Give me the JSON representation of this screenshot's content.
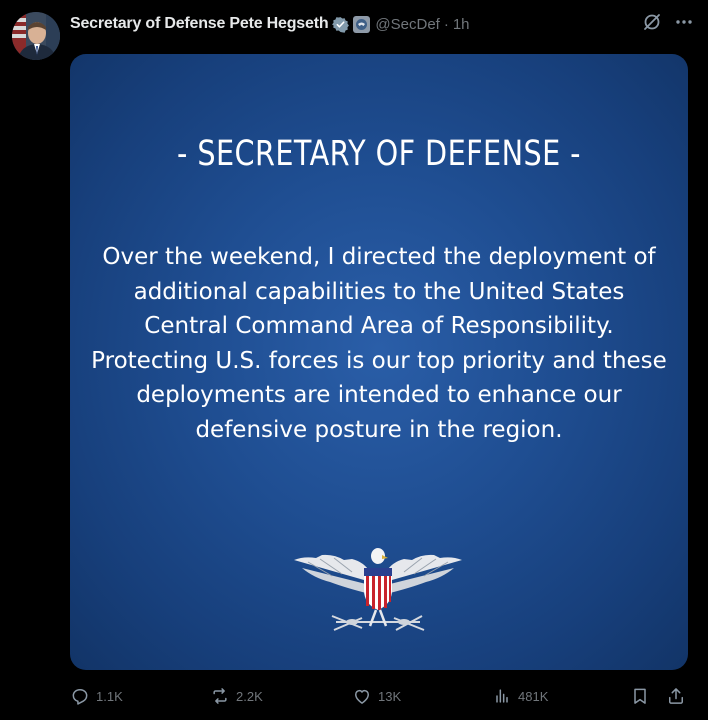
{
  "post": {
    "author": {
      "display_name": "Secretary of Defense Pete Hegseth",
      "handle": "@SecDef",
      "separator": "·",
      "time": "1h",
      "verified": true
    },
    "media": {
      "title": "- SECRETARY OF DEFENSE -",
      "body": "Over the weekend, I directed the deployment of additional capabilities to the United States Central Command Area of Responsibility. Protecting U.S. forces is our top priority and these deployments are intended to enhance our defensive posture in the region.",
      "background_color": "#1f4e92",
      "emblem": "eagle-emblem"
    },
    "stats": {
      "replies": "1.1K",
      "reposts": "2.2K",
      "likes": "13K",
      "views": "481K"
    }
  },
  "icons": {
    "reply": "reply-icon",
    "repost": "repost-icon",
    "like": "heart-icon",
    "views": "views-icon",
    "bookmark": "bookmark-icon",
    "share": "share-icon",
    "grok": "grok-icon",
    "more": "more-icon",
    "verified": "verified-badge-icon",
    "affiliation": "affiliation-badge-icon"
  },
  "colors": {
    "background": "#000000",
    "text_primary": "#e7e9ea",
    "text_secondary": "#71767b",
    "verified_badge": "#829aab"
  }
}
